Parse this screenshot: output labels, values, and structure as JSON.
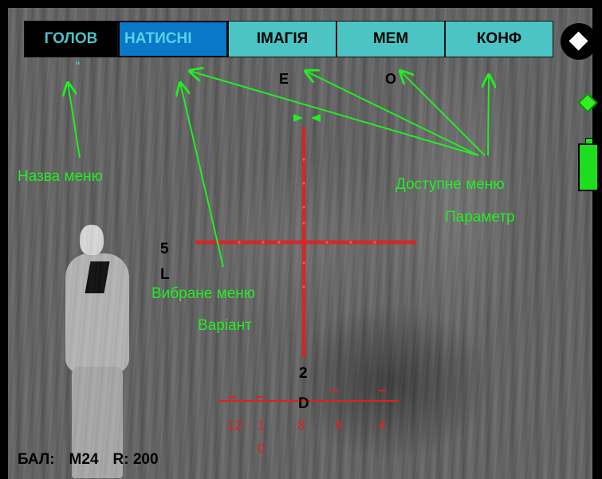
{
  "menu": {
    "title": "ГОЛОВ",
    "title_tail": "\"",
    "selected_option": "НАТИСНІ",
    "options": [
      "ІМАГІЯ",
      "МЕМ",
      "КОНФ"
    ],
    "option_tails": [
      "E",
      "O"
    ]
  },
  "annotations": {
    "menu_name": "Назва меню",
    "available_menu_line1": "Доступне меню",
    "available_menu_line2": "Параметр",
    "selected_menu_line1": "Вибране меню",
    "selected_menu_line2": "Варіант"
  },
  "reticle": {
    "left_marker_line1": "5",
    "left_marker_line2": "L",
    "bottom_marker_line1": "2",
    "bottom_marker_line2": "D",
    "range_scale": [
      "12",
      "1",
      "0",
      "8",
      "6",
      "4"
    ]
  },
  "status": {
    "ballistic_label": "БАЛ:",
    "ballistic_value": "M24",
    "range_label": "R: 200"
  },
  "colors": {
    "annotation": "#22ee22",
    "reticle": "#e02020",
    "menu_selected": "#0a78c8",
    "menu_available": "#4cc4c4",
    "menu_title_bg": "#000000",
    "battery": "#1ddd1d"
  },
  "icons": [
    "circle-diamond-icon",
    "green-diamond-icon",
    "battery-icon"
  ]
}
